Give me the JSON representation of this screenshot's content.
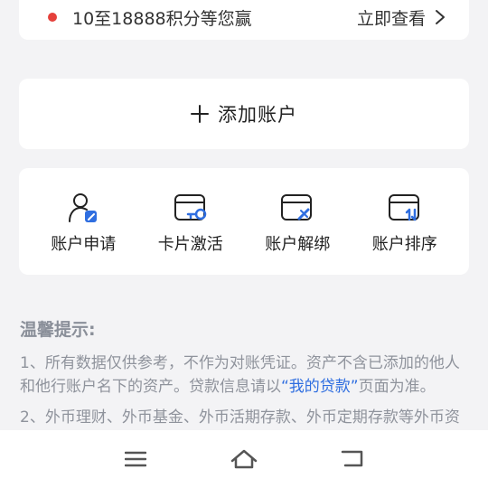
{
  "promo": {
    "text": "10至18888积分等您赢",
    "link_label": "立即查看"
  },
  "add_account": {
    "label": "添加账户"
  },
  "actions": [
    {
      "label": "账户申请",
      "icon": "user-edit-icon"
    },
    {
      "label": "卡片激活",
      "icon": "card-key-icon"
    },
    {
      "label": "账户解绑",
      "icon": "card-unlink-icon"
    },
    {
      "label": "账户排序",
      "icon": "card-sort-icon"
    }
  ],
  "tips": {
    "title": "温馨提示:",
    "item1_before": "1、所有数据仅供参考，不作为对账凭证。资产不含已添加的他人和他行账户名下的资产。贷款信息请以",
    "item1_link": "“我的贷款”",
    "item1_after": "页面为准。",
    "item2": "2、外币理财、外币基金、外币活期存款、外币定期存款等外币资"
  },
  "colors": {
    "accent_blue": "#2f6ee0",
    "promo_dot": "#e5403b",
    "background": "#f3f3f5"
  },
  "navbar": {
    "items": [
      "menu-icon",
      "home-icon",
      "back-icon"
    ]
  }
}
